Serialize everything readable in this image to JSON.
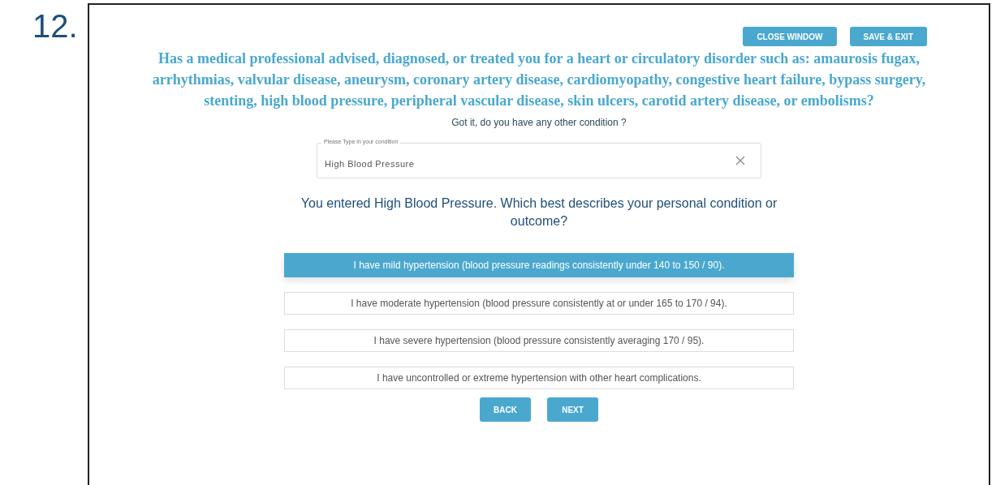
{
  "slide_number": "12.",
  "header_buttons": [
    "CLOSE WINDOW",
    "SAVE & EXIT"
  ],
  "question": "Has a medical professional advised, diagnosed, or treated you for a heart or circulatory disorder such as: amaurosis fugax, arrhythmias, valvular disease, aneurysm, coronary artery disease, cardiomyopathy, congestive heart failure, bypass surgery, stenting, high blood pressure, peripheral vascular disease, skin ulcers, carotid artery disease, or embolisms?",
  "follow_up": "Got it, do you have any other condition ?",
  "condition_field": {
    "label": "Please Type in your condition",
    "value": "High Blood Pressure"
  },
  "prompt": "You entered High Blood Pressure. Which best describes your personal condition or outcome?",
  "options": [
    {
      "label": "I have mild hypertension (blood pressure readings consistently under 140 to 150 / 90).",
      "selected": true
    },
    {
      "label": "I have moderate hypertension (blood pressure consistently at or under 165 to 170 / 94).",
      "selected": false
    },
    {
      "label": "I have severe hypertension (blood pressure consistently averaging 170 / 95).",
      "selected": false
    },
    {
      "label": "I have uncontrolled or extreme hypertension with other heart complications.",
      "selected": false
    }
  ],
  "nav_buttons": [
    "BACK",
    "NEXT"
  ]
}
